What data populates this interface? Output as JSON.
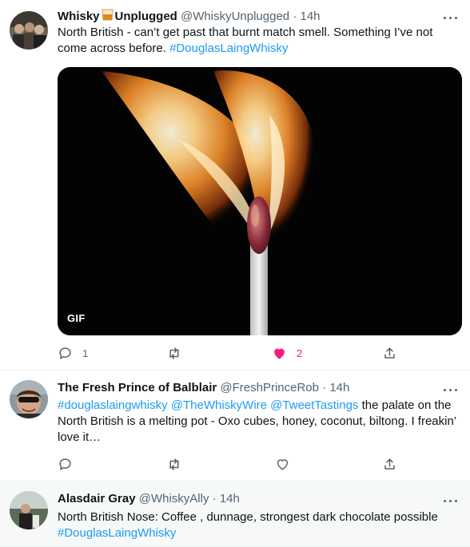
{
  "tweets": [
    {
      "name": "Whisky",
      "name_suffix": "Unplugged",
      "handle": "@WhiskyUnplugged",
      "time": "14h",
      "body": "North British - can’t get past that burnt match smell. Something I’ve not come across before.",
      "hashtag": "#DouglasLaingWhisky",
      "media_badge": "GIF",
      "replies": "1",
      "likes": "2",
      "liked": true
    },
    {
      "name": "The Fresh Prince of Balblair",
      "handle": "@FreshPrinceRob",
      "time": "14h",
      "mentions": [
        "#douglaslaingwhisky",
        "@TheWhiskyWire",
        "@TweetTastings"
      ],
      "body": "the palate on the North British is a melting pot - Oxo cubes, honey, coconut, biltong. I freakin’ love it…"
    },
    {
      "name": "Alasdair Gray",
      "handle": "@WhiskyAlly",
      "time": "14h",
      "body": "North British Nose: Coffee , dunnage, strongest dark chocolate possible",
      "hashtag": "#DouglasLaingWhisky"
    }
  ],
  "separator": "·",
  "icons": {
    "reply": "reply-icon",
    "retweet": "retweet-icon",
    "like": "heart-icon",
    "share": "share-icon",
    "more": "more-icon"
  },
  "colors": {
    "link": "#1d9bf0",
    "like": "#f91880",
    "muted": "#536471",
    "text": "#0f1419"
  }
}
